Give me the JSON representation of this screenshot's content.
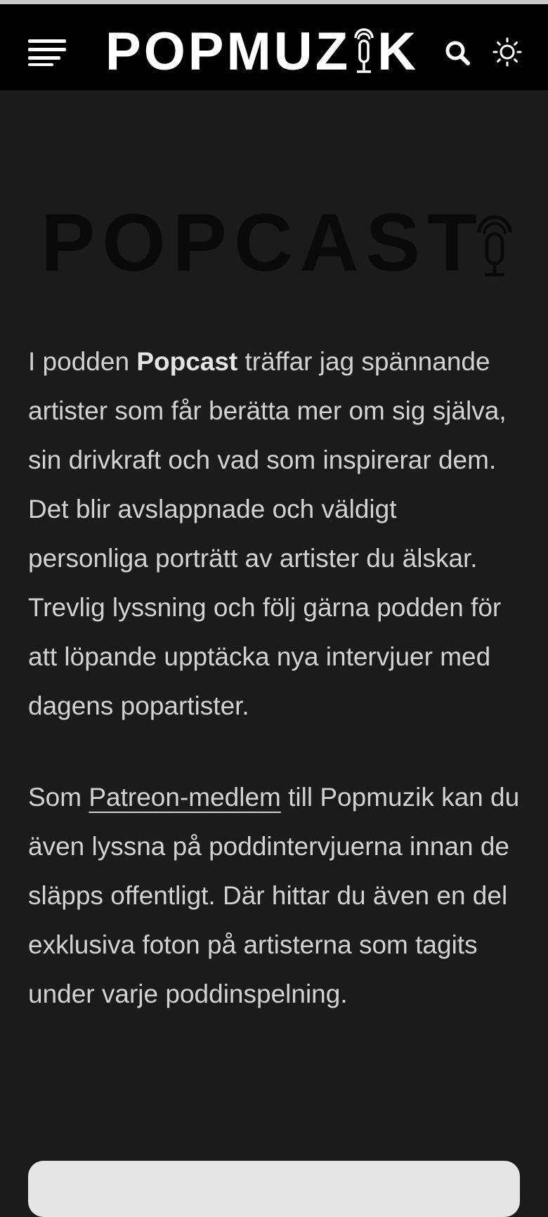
{
  "header": {
    "logo_text_left": "POPMUZ",
    "logo_text_right": "K",
    "logo_alt": "POPMUZIK"
  },
  "hero": {
    "logo_text": "POPCAST"
  },
  "intro": {
    "part1": "I podden ",
    "bold": "Popcast",
    "part2": " träffar jag spännande artister som får berätta mer om sig själva, sin drivkraft och vad som inspirerar dem.",
    "line2": "Det blir avslappnade och väldigt personliga porträtt av artister du älskar.",
    "line3": "Trevlig lyssning och följ gärna podden för att löpande upptäcka nya intervjuer med dagens popartister."
  },
  "patreon": {
    "before": "Som ",
    "link": "Patreon-medlem",
    "after": " till Popmuzik kan du även lyssna på poddintervjuerna innan de släpps offentligt. Där hittar du även en del exklusiva foton på artisterna som tagits under varje poddinspelning."
  },
  "icons": {
    "menu": "hamburger-icon",
    "search": "search-icon",
    "theme": "sun-icon",
    "mic": "microphone-icon"
  },
  "colors": {
    "header_bg": "#000000",
    "page_bg": "#1b1b1b",
    "text": "#d2d2d2",
    "card_bg": "#e5e5e5"
  }
}
